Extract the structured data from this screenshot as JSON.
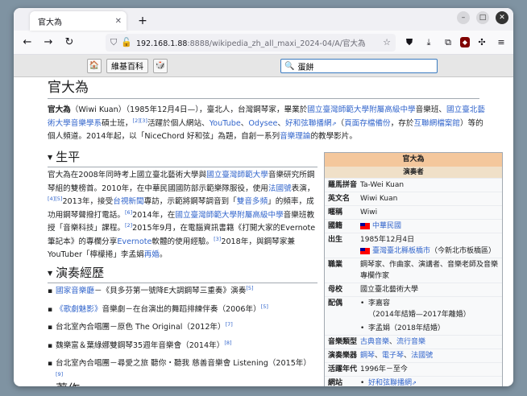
{
  "browser": {
    "tab_title": "官大為",
    "url_host": "192.168.1.88",
    "url_path": ":8888/wikipedia_zh_all_maxi_2024-04/A/官大為"
  },
  "kiwix": {
    "home_label": "🏠",
    "wiki_label": "維基百科",
    "random_label": "🎲",
    "search_value": "蛋餅"
  },
  "article": {
    "title": "官大為",
    "intro": {
      "bold": "官大為",
      "t1": "（Wiwi Kuan）（1985年12月4日—），臺北人，台灣鋼琴家，畢業於",
      "l1": "國立臺灣師範大學附屬高級中學",
      "t2": "音樂班、",
      "l2": "國立臺北藝術大學音樂學系",
      "t3": "碩士班，",
      "s1": "[2]",
      "s2": "[3]",
      "t4": "活躍於個人網站、",
      "l3": "YouTube",
      "t5": "、",
      "l4": "Odysee",
      "t6": "、",
      "l5": "好和弦聯播網",
      "t7": "（",
      "l6": "頁面存檔備份",
      "t8": "，存於",
      "l7": "互聯網檔案館",
      "t9": "）等的個人頻道。2014年起，以「NiceChord 好和弦」為題，自創一系列",
      "l8": "音樂理論",
      "t10": "的教學影片。"
    },
    "sec1": {
      "heading": "生平",
      "t1": "官大為在2008年同時考上國立臺北藝術大學與",
      "l1": "國立臺灣師範大學",
      "t2": "音樂研究所鋼琴組的雙榜首。2010年，在中華民國國防部示範樂隊服役，使用",
      "l2": "法國號",
      "t3": "表演，",
      "s1": "[4]",
      "s2": "[5]",
      "t4": "2013年，接受",
      "l3": "台視新聞",
      "t5": "專訪，示範將鋼琴調音到「",
      "l4": "雙音多頻",
      "t6": "」的頻率，成功用鋼琴聲撥打電話。",
      "s3": "[6]",
      "t7": "2014年，在",
      "l5": "國立臺灣師範大學附屬高級中學",
      "t8": "音樂班教授「音樂科技」課程。",
      "s4": "[2]",
      "t9": "2015年9月，在電腦資訊書籍《打開大家的Evernote筆記本》的專欄分享",
      "l6": "Evernote",
      "t10": "軟體的使用經驗。",
      "s5": "[3]",
      "t11": "2018年，與鋼琴家兼YouTuber「檸檬捲」李孟娟",
      "l7": "再婚",
      "t12": "。"
    },
    "sec2": {
      "heading": "演奏經歷",
      "items": [
        {
          "link": "國家音樂廳",
          "text": "－《貝多芬第一號降E大調鋼琴三重奏》演奏",
          "sup": "[5]"
        },
        {
          "link": "《歌劇魅影》",
          "text": "音樂劇－在台演出的舞蹈排練伴奏（2006年）",
          "sup": "[5]"
        },
        {
          "link": "",
          "text": "台北室內合唱團－原色 The Original（2012年）",
          "sup": "[7]"
        },
        {
          "link": "",
          "text": "魏樂富＆葉綠娜雙鋼琴35週年音樂會（2014年）",
          "sup": "[8]"
        },
        {
          "link": "",
          "text": "台北室內合唱團－尋愛之旅 聽你・聽我 慈善音樂會 Listening（2015年）",
          "sup": "[9]"
        }
      ]
    },
    "sec3": {
      "heading": "著作"
    }
  },
  "infobox": {
    "title": "官大為",
    "subtitle": "演奏者",
    "rows": [
      {
        "key": "羅馬拼音",
        "value": "Ta-Wei Kuan"
      },
      {
        "key": "英文名",
        "value": "Wiwi Kuan"
      },
      {
        "key": "暱稱",
        "value": "Wiwi"
      },
      {
        "key": "國籍",
        "value": "中華民國"
      },
      {
        "key": "出生",
        "date": "1985年12月4日",
        "place_link": "臺灣臺北縣板橋市",
        "place_rest": "（今新北市板橋區）"
      },
      {
        "key": "職業",
        "value": "鋼琴家、作曲家、演講者、音樂老師及音樂專欄作家"
      },
      {
        "key": "母校",
        "value": "國立臺北藝術大學"
      },
      {
        "key": "配偶",
        "spouse1": "李嘉容",
        "spouse1_note": "（2014年結婚—2017年離婚）",
        "spouse2": "李孟娟（2018年結婚）"
      },
      {
        "key": "音樂類型",
        "v1": "古典音樂",
        "sep": "、",
        "v2": "流行音樂"
      },
      {
        "key": "演奏樂器",
        "v1": "鋼琴",
        "v2": "電子琴",
        "v3": "法國號"
      },
      {
        "key": "活躍年代",
        "value": "1996年－至今"
      },
      {
        "key": "網站",
        "value": "好和弦聯播網"
      }
    ]
  }
}
